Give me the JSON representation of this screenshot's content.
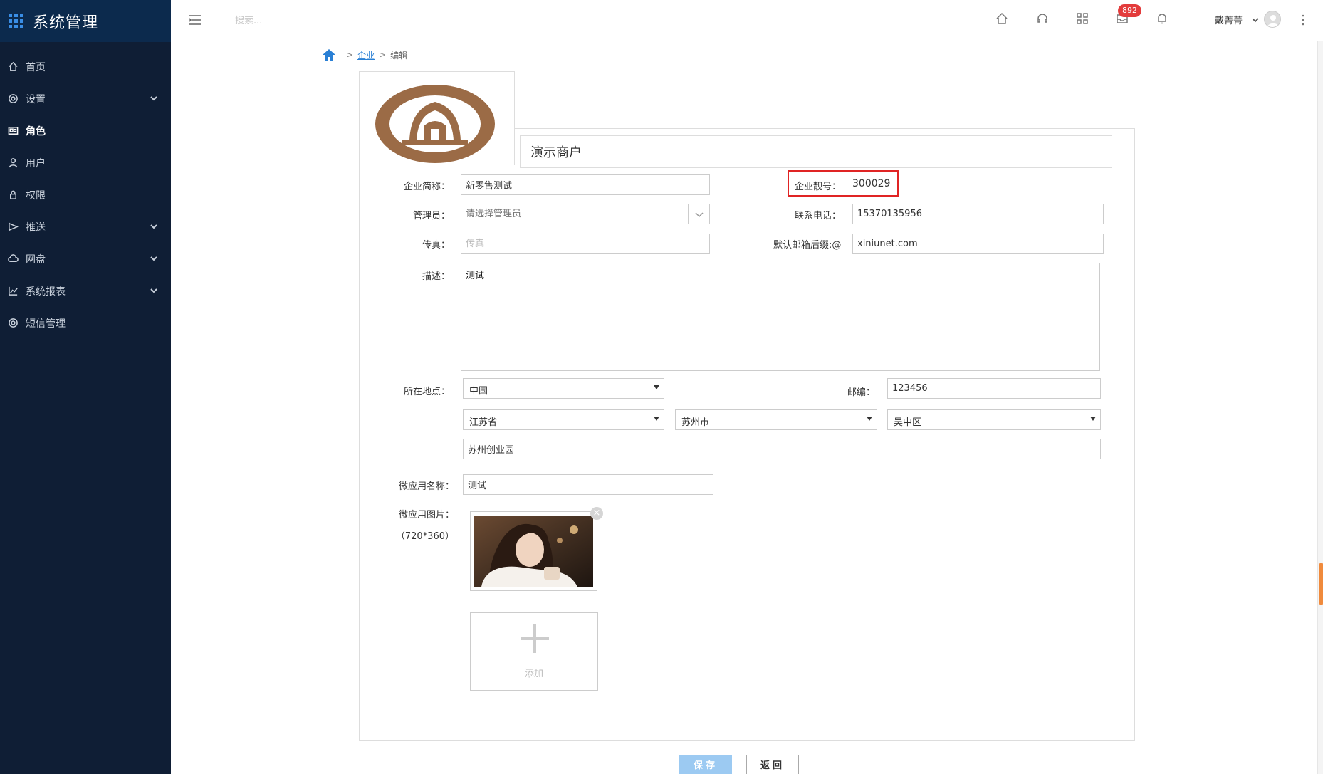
{
  "sidebar": {
    "title": "系统管理",
    "items": [
      {
        "label": "首页",
        "icon": "home-icon"
      },
      {
        "label": "设置",
        "icon": "gear-icon",
        "expandable": true
      },
      {
        "label": "角色",
        "icon": "id-card-icon",
        "active": true
      },
      {
        "label": "用户",
        "icon": "user-icon"
      },
      {
        "label": "权限",
        "icon": "lock-icon"
      },
      {
        "label": "推送",
        "icon": "send-icon",
        "expandable": true
      },
      {
        "label": "网盘",
        "icon": "cloud-icon",
        "expandable": true
      },
      {
        "label": "系统报表",
        "icon": "chart-icon",
        "expandable": true
      },
      {
        "label": "短信管理",
        "icon": "gear-icon"
      }
    ]
  },
  "topbar": {
    "search_placeholder": "搜索...",
    "badge_count": "892",
    "user_name": "戴菁菁"
  },
  "breadcrumb": {
    "parent": "企业",
    "current": "编辑",
    "sep": ">"
  },
  "form": {
    "company_name": "演示商户",
    "short_name_label": "企业简称：",
    "short_name": "新零售测试",
    "code_label": "企业靓号：",
    "code": "300029",
    "admin_label": "管理员：",
    "admin_placeholder": "请选择管理员",
    "phone_label": "联系电话：",
    "phone": "15370135956",
    "fax_label": "传真：",
    "fax_placeholder": "传真",
    "email_suffix_label": "默认邮箱后缀:@",
    "email_suffix": "xiniunet.com",
    "desc_label": "描述：",
    "desc": "测试",
    "location_label": "所在地点：",
    "country": "中国",
    "zip_label": "邮编：",
    "zip": "123456",
    "province": "江苏省",
    "city": "苏州市",
    "district": "吴中区",
    "address": "苏州创业园",
    "app_name_label": "微应用名称：",
    "app_name": "测试",
    "app_image_label": "微应用图片：",
    "app_image_size": "（720*360）",
    "add_label": "添加",
    "close_glyph": "×"
  },
  "buttons": {
    "save": "保存",
    "back": "返回"
  },
  "colors": {
    "sidebar_bg": "#0f1e35",
    "brand_bg": "#0c2a4d",
    "accent": "#2a80d5",
    "highlight_border": "#e02424",
    "badge": "#e33b3b"
  }
}
